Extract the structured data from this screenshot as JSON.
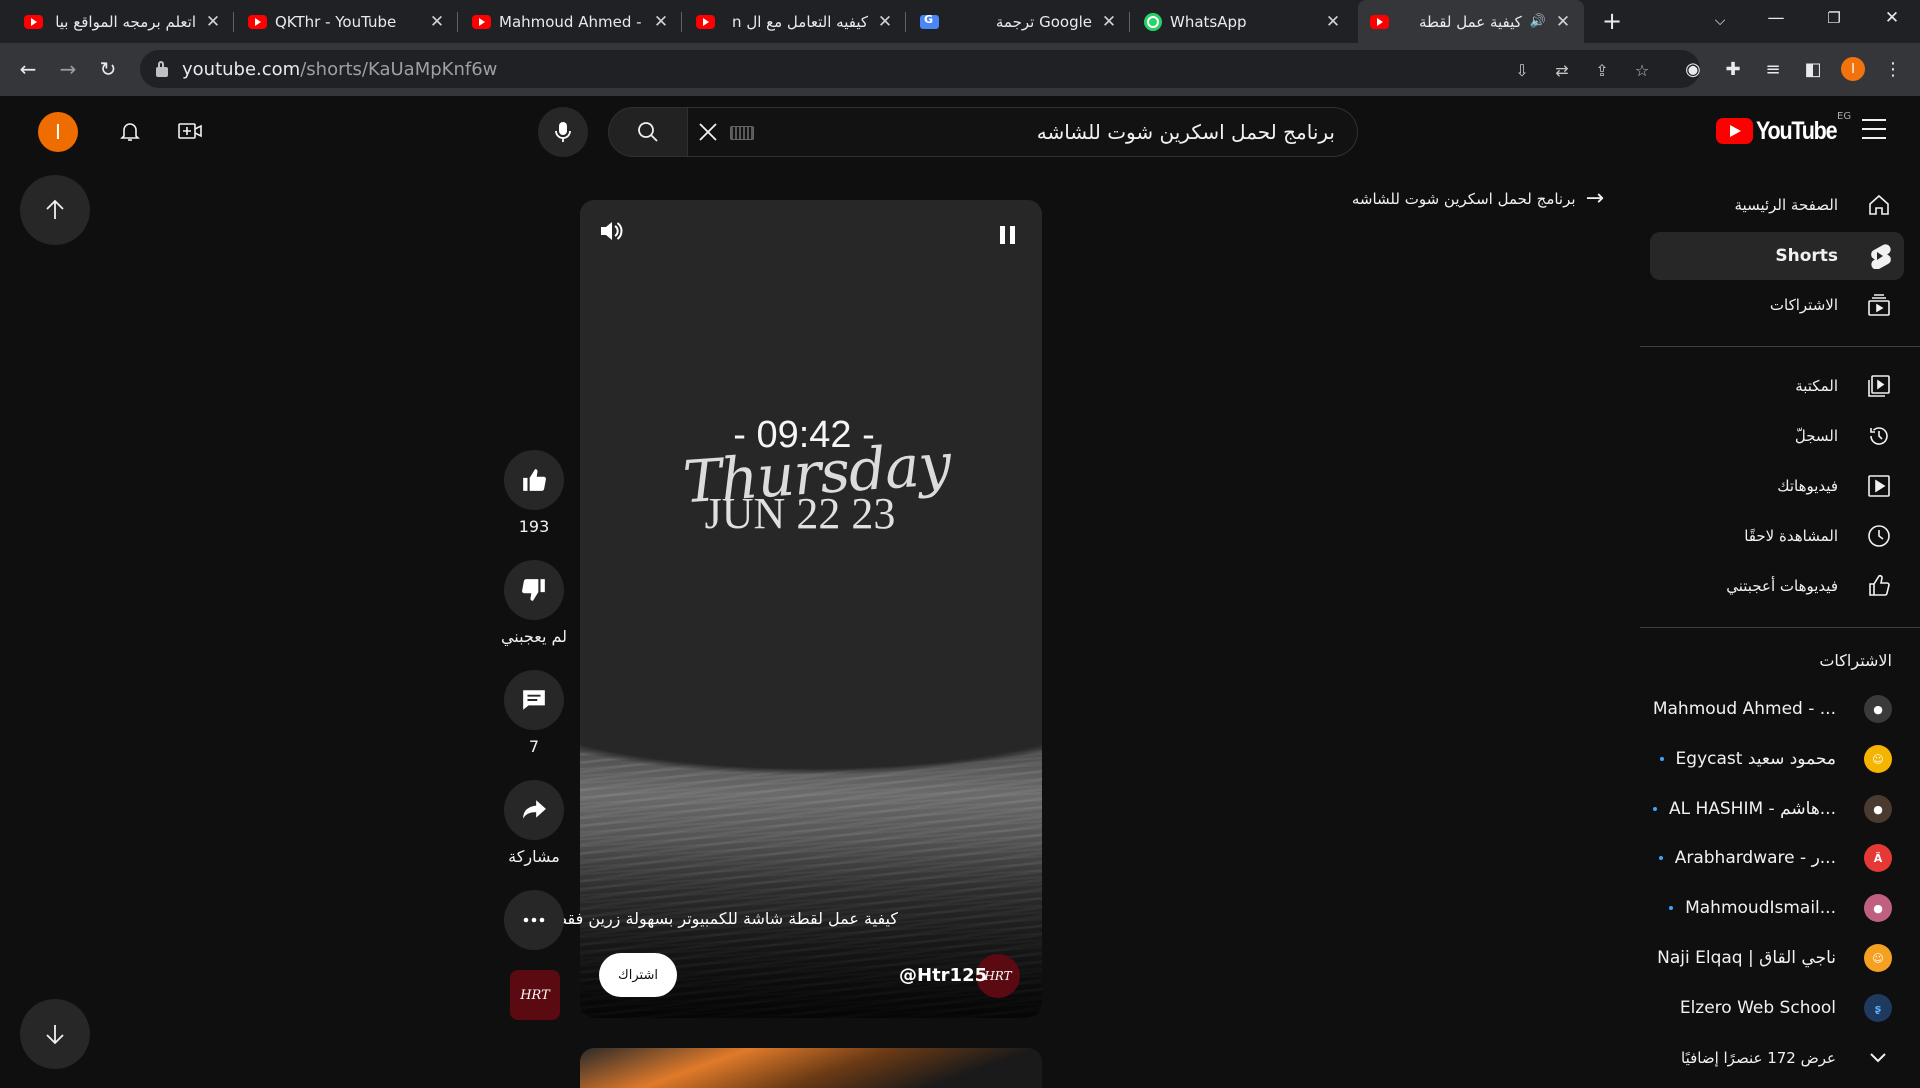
{
  "browser": {
    "tabs": [
      {
        "title": "اتعلم برمجه المواقع بيا",
        "icon": "youtube-favicon-icon"
      },
      {
        "title": "QKThr - YouTube",
        "icon": "youtube-favicon-icon"
      },
      {
        "title": "Mahmoud Ahmed - ...",
        "icon": "youtube-favicon-icon"
      },
      {
        "title": "كيفيه التعامل مع ال n",
        "icon": "youtube-favicon-icon"
      },
      {
        "title": "Google ترجمة",
        "icon": "google-translate-icon"
      },
      {
        "title": "WhatsApp",
        "icon": "whatsapp-icon"
      },
      {
        "title": "كيفية عمل لقطة",
        "icon": "youtube-favicon-icon",
        "active": true
      }
    ],
    "url_host": "youtube.com",
    "url_path": "/shorts/KaUaMpKnf6w",
    "profile_initial": "I"
  },
  "masthead": {
    "avatar_initial": "I",
    "search_query": "برنامج لحمل اسكرين شوت للشاشه",
    "logo_text": "YouTube",
    "country_code": "EG"
  },
  "sidebar": {
    "primary": [
      {
        "label": "الصفحة الرئيسية",
        "icon": "home-icon"
      },
      {
        "label": "Shorts",
        "icon": "shorts-icon",
        "active": true
      },
      {
        "label": "الاشتراكات",
        "icon": "subscriptions-icon"
      }
    ],
    "library": [
      {
        "label": "المكتبة",
        "icon": "library-icon"
      },
      {
        "label": "السجلّ",
        "icon": "history-icon"
      },
      {
        "label": "فيديوهاتك",
        "icon": "your-videos-icon"
      },
      {
        "label": "المشاهدة لاحقًا",
        "icon": "watch-later-icon"
      },
      {
        "label": "فيديوهات أعجبتني",
        "icon": "liked-videos-icon"
      }
    ],
    "subscriptions_heading": "الاشتراكات",
    "subscriptions": [
      {
        "name": "Mahmoud Ahmed - ...",
        "new": false,
        "color": "#3a3a3a"
      },
      {
        "name": "Egycast محمود سعيد",
        "new": true,
        "color": "#f4b400"
      },
      {
        "name": "AL HASHIM - هاشم...",
        "new": true,
        "color": "#4a3a30"
      },
      {
        "name": "Arabhardware - ر...",
        "new": true,
        "color": "#e53935"
      },
      {
        "name": "MahmoudIsmail...",
        "new": true,
        "color": "#c06080"
      },
      {
        "name": "Naji Elqaq | ناجي القاق",
        "new": false,
        "color": "#f4a020"
      },
      {
        "name": "Elzero Web School",
        "new": false,
        "color": "#1e3a5f"
      }
    ],
    "show_more": "عرض 172 عنصرًا إضافيًا"
  },
  "short": {
    "related_search": "برنامج لحمل اسكرين شوت للشاشه",
    "clock_time": "- 09:42 -",
    "clock_day": "Thursday",
    "clock_date": "JUN 22 23",
    "caption": "كيفية عمل لقطة شاشة للكمبيوتر بسهولة زرين فقط✓",
    "channel": "@Htr125",
    "channel_avatar_text": "HRT",
    "subscribe_label": "اشتراك"
  },
  "actions": {
    "likes": "193",
    "dislike_label": "لم يعجبني",
    "comments": "7",
    "share_label": "مشاركة"
  }
}
